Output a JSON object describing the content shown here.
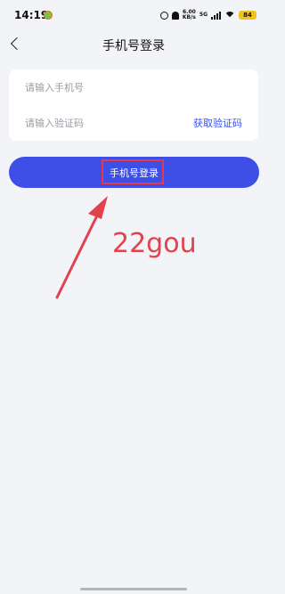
{
  "status_bar": {
    "time": "14:19",
    "net_speed_value": "6.00",
    "net_speed_unit": "KB/s",
    "network_label": "5G",
    "battery": "84"
  },
  "header": {
    "title": "手机号登录"
  },
  "form": {
    "phone_placeholder": "请输入手机号",
    "code_placeholder": "请输入验证码",
    "get_code_label": "获取验证码"
  },
  "login_button_label": "手机号登录",
  "annotation": {
    "text": "22gou",
    "color": "#e3424d"
  },
  "colors": {
    "accent": "#3e4fe7",
    "link": "#3c50e6",
    "background": "#f3f4f8",
    "highlight": "#e8394b"
  }
}
